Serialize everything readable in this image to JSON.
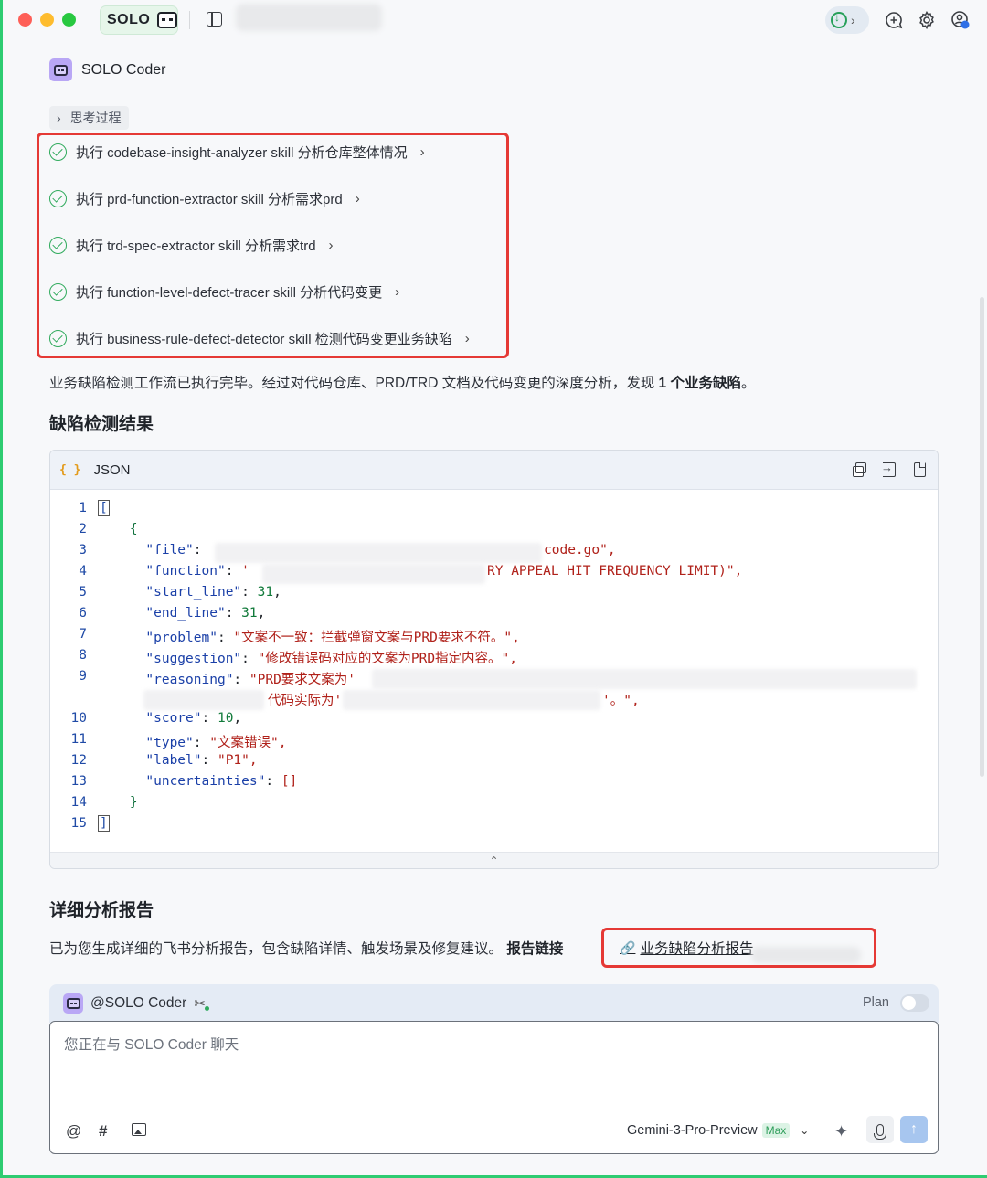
{
  "titlebar": {
    "app_badge": "SOLO",
    "icons": [
      "sidebar-toggle-icon",
      "update-icon",
      "new-chat-icon",
      "gear-icon",
      "account-icon"
    ]
  },
  "header": {
    "agent_name": "SOLO Coder"
  },
  "thinking": {
    "label": "思考过程"
  },
  "steps": [
    {
      "label": "执行 codebase-insight-analyzer skill 分析仓库整体情况"
    },
    {
      "label": "执行 prd-function-extractor skill 分析需求prd"
    },
    {
      "label": "执行 trd-spec-extractor skill 分析需求trd"
    },
    {
      "label": "执行 function-level-defect-tracer skill 分析代码变更"
    },
    {
      "label": "执行 business-rule-defect-detector skill 检测代码变更业务缺陷"
    }
  ],
  "summary": {
    "text": "业务缺陷检测工作流已执行完毕。经过对代码仓库、PRD/TRD 文档及代码变更的深度分析，发现 ",
    "bold": "1 个业务缺陷",
    "tail": "。"
  },
  "results_heading": "缺陷检测结果",
  "code_block": {
    "language": "JSON",
    "line_numbers": [
      "1",
      "2",
      "3",
      "4",
      "5",
      "6",
      "7",
      "8",
      "9",
      "",
      "10",
      "11",
      "12",
      "13",
      "14",
      "15"
    ],
    "lines": {
      "l1": "[",
      "l2": "{",
      "l3_key": "\"file\"",
      "l3_val": "code.go\",",
      "l4_key": "\"function\"",
      "l4_val_a": "'",
      "l4_val_b": "RY_APPEAL_HIT_FREQUENCY_LIMIT)\",",
      "l5_key": "\"start_line\"",
      "l5_val": "31",
      "l6_key": "\"end_line\"",
      "l6_val": "31",
      "l7_key": "\"problem\"",
      "l7_val": "\"文案不一致：拦截弹窗文案与PRD要求不符。\",",
      "l8_key": "\"suggestion\"",
      "l8_val": "\"修改错误码对应的文案为PRD指定内容。\",",
      "l9_key": "\"reasoning\"",
      "l9_val": "\"PRD要求文案为'",
      "l9b_val_a": "代码实际为'",
      "l9b_val_b": "'。\",",
      "l10_key": "\"score\"",
      "l10_val": "10",
      "l11_key": "\"type\"",
      "l11_val": "\"文案错误\",",
      "l12_key": "\"label\"",
      "l12_val": "\"P1\",",
      "l13_key": "\"uncertainties\"",
      "l13_val": "[]",
      "l14": "}",
      "l15": "]"
    }
  },
  "report_heading": "详细分析报告",
  "report": {
    "text": "已为您生成详细的飞书分析报告，包含缺陷详情、触发场景及修复建议。 ",
    "bold": "报告链接",
    "link_label": "业务缺陷分析报告"
  },
  "composer": {
    "agent_mention": "@SOLO Coder",
    "plan_label": "Plan",
    "plan_enabled": false,
    "placeholder": "您正在与 SOLO Coder 聊天",
    "model": "Gemini-3-Pro-Preview",
    "model_badge": "Max"
  },
  "colors": {
    "highlight_border": "#e53935",
    "success": "#2faa5c",
    "string": "#b0211a",
    "key": "#1b40a8",
    "number": "#117a3a"
  }
}
